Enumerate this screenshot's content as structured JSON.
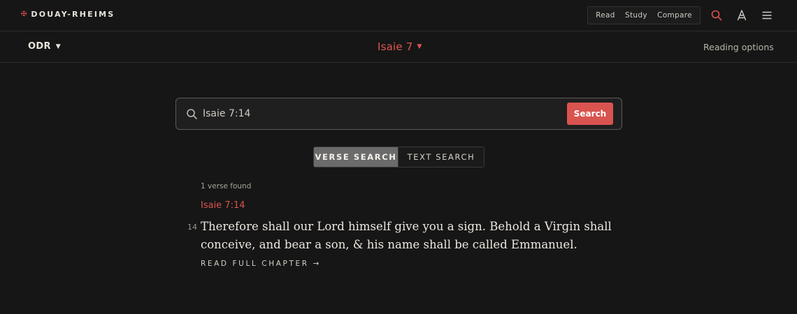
{
  "header": {
    "brand_mark": "✠",
    "brand": "DOUAY-RHEIMS",
    "nav": [
      "Read",
      "Study",
      "Compare"
    ],
    "icons": {
      "search": "search-icon",
      "ladder": "ladder-icon",
      "menu": "menu-icon"
    }
  },
  "subheader": {
    "version": "ODR",
    "chapter": "Isaie 7",
    "reading_options": "Reading options"
  },
  "search": {
    "value": "Isaie 7:14",
    "button": "Search"
  },
  "modes": {
    "verse": "VERSE SEARCH",
    "text": "TEXT SEARCH",
    "active": "verse"
  },
  "results": {
    "count": "1 verse found",
    "reference": "Isaie 7:14",
    "verse_number": "14",
    "verse_text": "Therefore shall our Lord himself give you a sign. Behold a Virgin shall conceive, and bear a son, & his name shall be called Emmanuel.",
    "read_full": "READ FULL CHAPTER →"
  },
  "colors": {
    "accent": "#d9534f",
    "background": "#161616",
    "text": "#e8e4dc"
  }
}
